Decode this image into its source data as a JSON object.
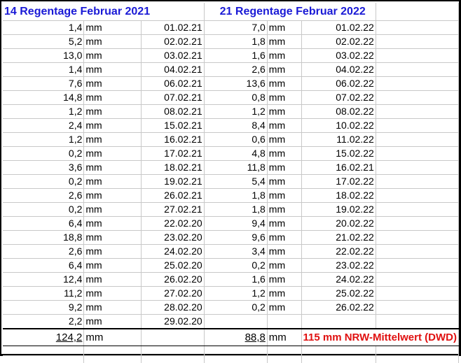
{
  "sheet": {
    "left_title": "14 Regentage Februar 2021",
    "right_title": "21 Regentage Februar 2022",
    "unit": "mm",
    "rows": [
      {
        "l_val": "1,4",
        "l_date": "01.02.21",
        "r_val": "7,0",
        "r_date": "01.02.22"
      },
      {
        "l_val": "5,2",
        "l_date": "02.02.21",
        "r_val": "1,8",
        "r_date": "02.02.22"
      },
      {
        "l_val": "13,0",
        "l_date": "03.02.21",
        "r_val": "1,6",
        "r_date": "03.02.22"
      },
      {
        "l_val": "1,4",
        "l_date": "04.02.21",
        "r_val": "2,6",
        "r_date": "04.02.22"
      },
      {
        "l_val": "7,6",
        "l_date": "06.02.21",
        "r_val": "13,6",
        "r_date": "06.02.22"
      },
      {
        "l_val": "14,8",
        "l_date": "07.02.21",
        "r_val": "0,8",
        "r_date": "07.02.22"
      },
      {
        "l_val": "1,2",
        "l_date": "08.02.21",
        "r_val": "1,2",
        "r_date": "08.02.22"
      },
      {
        "l_val": "2,4",
        "l_date": "15.02.21",
        "r_val": "8,4",
        "r_date": "10.02.22"
      },
      {
        "l_val": "1,2",
        "l_date": "16.02.21",
        "r_val": "0,6",
        "r_date": "11.02.22"
      },
      {
        "l_val": "0,2",
        "l_date": "17.02.21",
        "r_val": "4,8",
        "r_date": "15.02.22"
      },
      {
        "l_val": "3,6",
        "l_date": "18.02.21",
        "r_val": "11,8",
        "r_date": "16.02.21"
      },
      {
        "l_val": "0,2",
        "l_date": "19.02.21",
        "r_val": "5,4",
        "r_date": "17.02.22"
      },
      {
        "l_val": "2,6",
        "l_date": "26.02.21",
        "r_val": "1,8",
        "r_date": "18.02.22"
      },
      {
        "l_val": "0,2",
        "l_date": "27.02.21",
        "r_val": "1,8",
        "r_date": "19.02.22"
      },
      {
        "l_val": "6,4",
        "l_date": "22.02.20",
        "r_val": "9,4",
        "r_date": "20.02.22"
      },
      {
        "l_val": "18,8",
        "l_date": "23.02.20",
        "r_val": "9,6",
        "r_date": "21.02.22"
      },
      {
        "l_val": "2,6",
        "l_date": "24.02.20",
        "r_val": "3,4",
        "r_date": "22.02.22"
      },
      {
        "l_val": "6,4",
        "l_date": "25.02.20",
        "r_val": "0,2",
        "r_date": "23.02.22"
      },
      {
        "l_val": "12,4",
        "l_date": "26.02.20",
        "r_val": "1,6",
        "r_date": "24.02.22"
      },
      {
        "l_val": "11,2",
        "l_date": "27.02.20",
        "r_val": "1,2",
        "r_date": "25.02.22"
      },
      {
        "l_val": "9,2",
        "l_date": "28.02.20",
        "r_val": "0,2",
        "r_date": "26.02.22"
      },
      {
        "l_val": "2,2",
        "l_date": "29.02.20",
        "r_val": "",
        "r_date": ""
      }
    ],
    "total": {
      "left_sum": "124,2",
      "right_sum": "88,8",
      "note": "115 mm NRW-Mittelwert (DWD)"
    }
  }
}
